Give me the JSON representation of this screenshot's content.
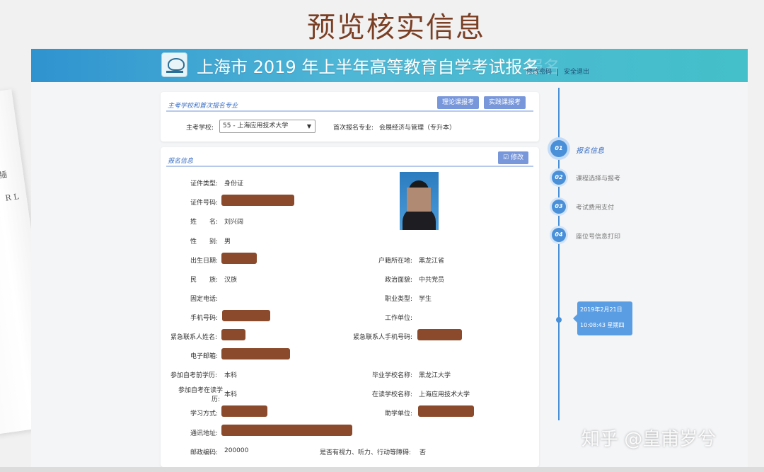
{
  "slide_title": "预览核实信息",
  "banner": {
    "title": "上海市 2019 年上半年高等教育自学考试报名",
    "ghost_text": "报名",
    "links": [
      "修改密码",
      "安全退出"
    ]
  },
  "section1": {
    "title": "主考学校和首次报名专业",
    "buttons": [
      "理论课报考",
      "实践课报考"
    ],
    "school_label": "主考学校:",
    "school_value": "55 - 上海应用技术大学",
    "major_label": "首次报名专业:",
    "major_value": "会展经济与管理（专升本）"
  },
  "section2": {
    "title": "报名信息",
    "edit_button": "修改",
    "fields": {
      "id_type": {
        "label": "证件类型:",
        "value": "身份证"
      },
      "id_number": {
        "label": "证件号码:"
      },
      "name": {
        "label": "姓　　名:",
        "value": "刘兴阔"
      },
      "gender": {
        "label": "性　　别:",
        "value": "男"
      },
      "birth": {
        "label": "出生日期:"
      },
      "hukou": {
        "label": "户籍所在地:",
        "value": "黑龙江省"
      },
      "ethnicity": {
        "label": "民　　族:",
        "value": "汉族"
      },
      "politics": {
        "label": "政治面貌:",
        "value": "中共党员"
      },
      "phone_fixed": {
        "label": "固定电话:"
      },
      "occupation": {
        "label": "职业类型:",
        "value": "学生"
      },
      "mobile": {
        "label": "手机号码:"
      },
      "employer": {
        "label": "工作单位:"
      },
      "emergency_name": {
        "label": "紧急联系人姓名:"
      },
      "emergency_phone": {
        "label": "紧急联系人手机号码:"
      },
      "email": {
        "label": "电子邮箱:"
      },
      "prior_edu": {
        "label": "参加自考前学历:",
        "value": "本科"
      },
      "grad_school": {
        "label": "毕业学校名称:",
        "value": "黑龙江大学"
      },
      "current_edu_1": {
        "label": "参加自考在读学"
      },
      "current_edu_2": {
        "label": "历:",
        "value": "本科"
      },
      "current_school": {
        "label": "在读学校名称:",
        "value": "上海应用技术大学"
      },
      "study_mode": {
        "label": "学习方式:"
      },
      "assist_unit": {
        "label": "助学单位:"
      },
      "address": {
        "label": "通讯地址:"
      },
      "postcode": {
        "label": "邮政编码:",
        "value": "200000"
      },
      "disability": {
        "label": "是否有视力、听力、行动等障碍:",
        "value": "否"
      }
    }
  },
  "timeline": {
    "steps": [
      {
        "num": "01",
        "label": "报名信息"
      },
      {
        "num": "02",
        "label": "课程选择与报考"
      },
      {
        "num": "03",
        "label": "考试费用支付"
      },
      {
        "num": "04",
        "label": "座位号信息打印"
      }
    ],
    "date": "2019年2月21日",
    "time": "10:08:43 星期四"
  },
  "watermark": "知乎 @皇甫岁兮",
  "colors": {
    "accent": "#4a90d9",
    "button": "#7897db",
    "title": "#7a3f24",
    "redaction": "#8b4a2b"
  }
}
